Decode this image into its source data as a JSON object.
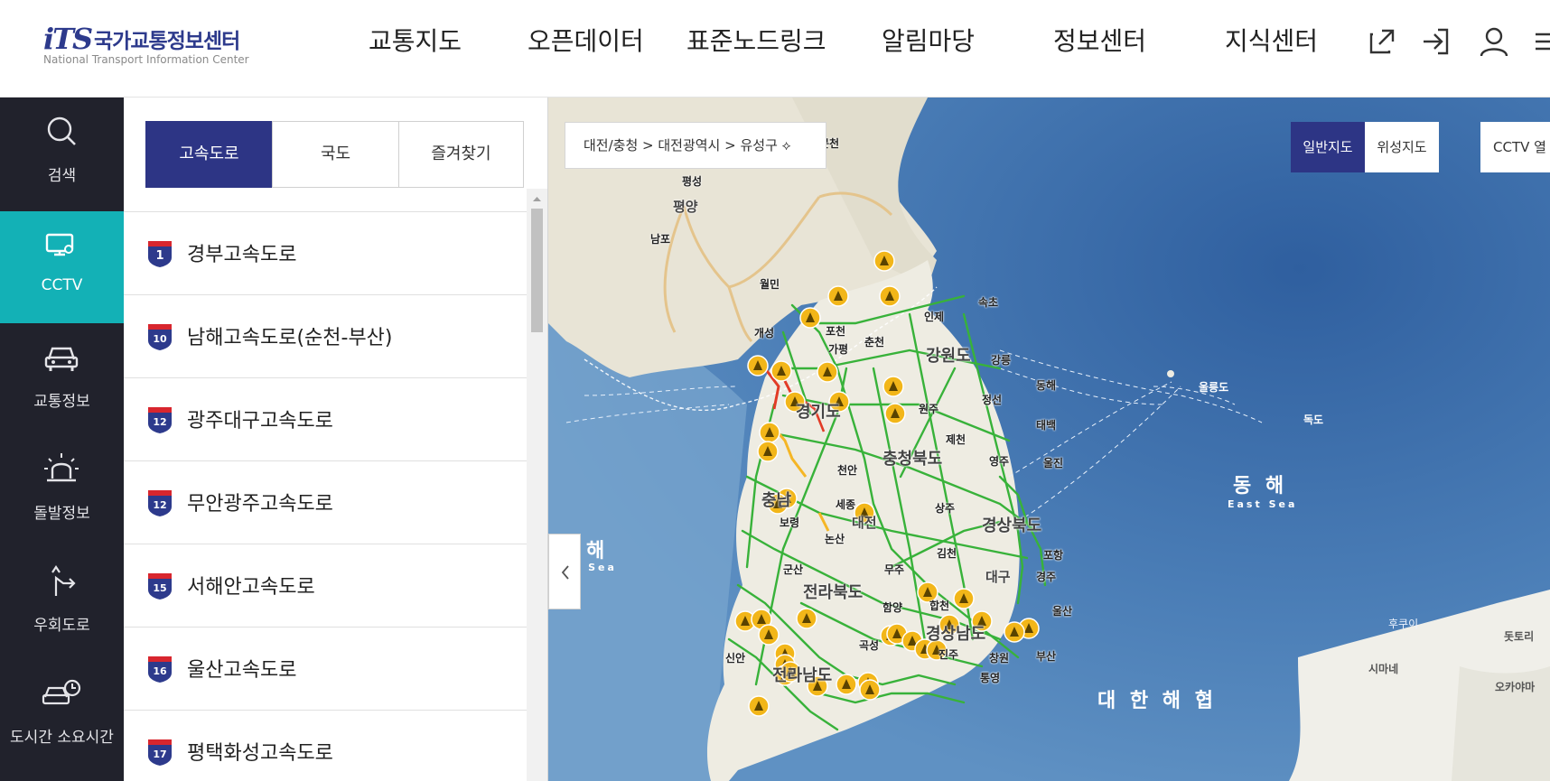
{
  "header": {
    "logo_mark": "iTS",
    "logo_name": "국가교통정보센터",
    "logo_sub": "National Transport Information Center",
    "nav": [
      "교통지도",
      "오픈데이터",
      "표준노드링크",
      "알림마당",
      "정보센터",
      "지식센터"
    ],
    "icons": [
      "external-link-icon",
      "login-icon",
      "user-icon",
      "menu-icon"
    ]
  },
  "rail": [
    {
      "label": "검색",
      "icon": "search-icon",
      "active": false
    },
    {
      "label": "CCTV",
      "icon": "cctv-icon",
      "active": true
    },
    {
      "label": "교통정보",
      "icon": "car-icon",
      "active": false
    },
    {
      "label": "돌발정보",
      "icon": "siren-icon",
      "active": false
    },
    {
      "label": "우회도로",
      "icon": "detour-icon",
      "active": false
    },
    {
      "label": "도시간 소요시간",
      "icon": "car-clock-icon",
      "active": false
    }
  ],
  "panel": {
    "tabs": [
      {
        "label": "고속도로",
        "active": true
      },
      {
        "label": "국도",
        "active": false
      },
      {
        "label": "즐겨찾기",
        "active": false
      }
    ],
    "roads": [
      {
        "num": "1",
        "name": "경부고속도로"
      },
      {
        "num": "10",
        "name": "남해고속도로(순천-부산)"
      },
      {
        "num": "12",
        "name": "광주대구고속도로"
      },
      {
        "num": "12",
        "name": "무안광주고속도로"
      },
      {
        "num": "15",
        "name": "서해안고속도로"
      },
      {
        "num": "16",
        "name": "울산고속도로"
      },
      {
        "num": "17",
        "name": "평택화성고속도로"
      }
    ]
  },
  "map": {
    "breadcrumb": "대전/충청  >  대전광역시  >  유성구 ⟡",
    "map_types": [
      {
        "label": "일반지도",
        "active": true
      },
      {
        "label": "위성지도",
        "active": false
      }
    ],
    "cctv_filter": "CCTV 열",
    "labels": {
      "pyongsong": "평성",
      "pyongyang": "평양",
      "nampo": "남포",
      "munchon": "문천",
      "wolmi": "월민",
      "gaeseong": "개성",
      "pocheon": "포천",
      "chuncheon": "춘천",
      "inje": "인제",
      "sokcho": "속초",
      "gapyeong": "가평",
      "gangwon": "강원도",
      "gangneung": "강릉",
      "donghae_city": "동해",
      "gyeonggi": "경기도",
      "wonju": "원주",
      "jeongseon": "정선",
      "taebaek": "태백",
      "jecheon": "제천",
      "chungbuk": "충청북도",
      "yeongju": "영주",
      "uljin": "울진",
      "cheonan": "천안",
      "chungnam": "충남",
      "sejong": "세종",
      "boryeong": "보령",
      "daejeon": "대전",
      "sangju": "상주",
      "gyeongbuk": "경상북도",
      "nonsan": "논산",
      "gimcheon": "김천",
      "pohang": "포항",
      "gunsan": "군산",
      "muju": "무주",
      "daegu": "대구",
      "gyeongju": "경주",
      "jeonbuk": "전라북도",
      "hamyang": "함양",
      "hapcheon": "합천",
      "ulsan": "울산",
      "gyeongnam": "경상남도",
      "jinju": "진주",
      "changwon": "창원",
      "busan": "부산",
      "jeonnam": "전라남도",
      "tongyeong": "통영",
      "gokseong": "곡성",
      "sinan": "신안",
      "ulleungdo": "울릉도",
      "dokdo": "독도",
      "yellow_sea_kr": "해",
      "yellow_sea_en": "llow Sea",
      "east_sea_kr": "동 해",
      "east_sea_en": "East Sea",
      "strait_kr": "대 한 해 협",
      "fukuoka": "후쿠이",
      "tottori": "돗토리",
      "shimane": "시마네",
      "okayama": "오카야마"
    }
  },
  "colors": {
    "primary": "#2d3585",
    "rail_bg": "#21222c",
    "rail_active": "#13b1b6",
    "road_green": "#38b23a",
    "cctv_marker": "#f2b619",
    "sea": "#3f6ea6"
  }
}
